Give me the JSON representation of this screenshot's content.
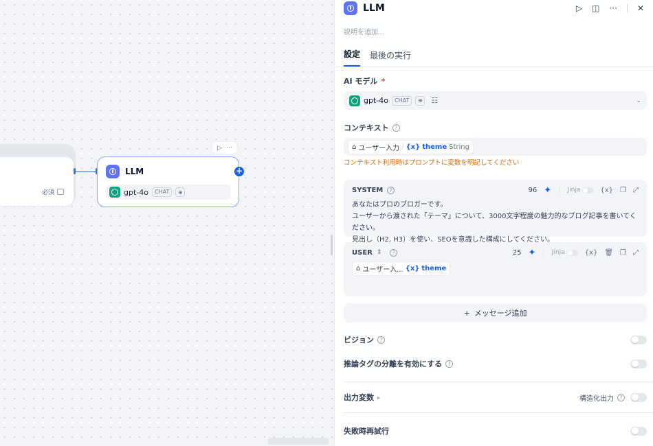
{
  "canvas": {
    "prev_node": {
      "required_label": "必須"
    },
    "llm_node": {
      "title": "LLM",
      "model_name": "gpt-4o",
      "model_tag": "CHAT"
    }
  },
  "panel": {
    "title": "LLM",
    "description_placeholder": "説明を追加...",
    "tabs": [
      {
        "label": "設定",
        "active": true
      },
      {
        "label": "最後の実行",
        "active": false
      }
    ],
    "ai_model": {
      "label": "AI モデル",
      "required_mark": "*",
      "name": "gpt-4o",
      "tag": "CHAT"
    },
    "context": {
      "label": "コンテキスト",
      "chip_source": "ユーザー入力",
      "chip_var": "theme",
      "chip_type": "String",
      "warning": "コンテキスト利用時はプロンプトに変数を明記してください"
    },
    "system_prompt": {
      "role": "SYSTEM",
      "count": "96",
      "jinja": "Jinja",
      "text": "あなたはプロのブロガーです。\nユーザーから渡された「テーマ」について、3000文字程度の魅力的なブログ記事を書いてください。\n見出し（H2, H3）を使い、SEOを意識した構成にしてください。"
    },
    "user_prompt": {
      "role": "USER",
      "count": "25",
      "jinja": "Jinja",
      "chip_source": "ユーザー入...",
      "chip_var": "theme"
    },
    "add_message_label": "メッセージ追加",
    "vision": {
      "label": "ビジョン",
      "enabled": false
    },
    "reasoning": {
      "label": "推論タグの分離を有効にする",
      "enabled": false
    },
    "output_vars": {
      "label": "出力変数",
      "structured_label": "構造化出力",
      "structured_enabled": false
    },
    "retry": {
      "label": "失敗時再試行",
      "enabled": false
    }
  },
  "colors": {
    "accent": "#155eef",
    "node_icon": "#6172f3",
    "gpt_icon": "#10a37f",
    "warning": "#dc6803",
    "required": "#f04438"
  }
}
